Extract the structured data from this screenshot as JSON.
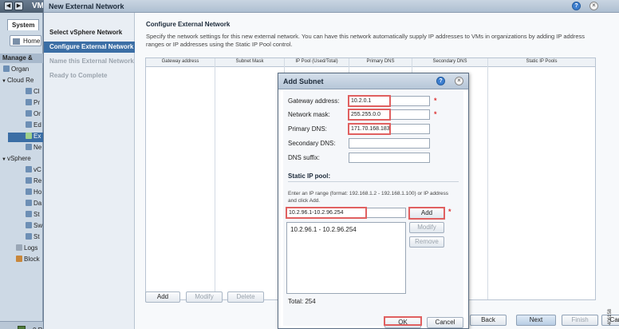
{
  "app": {
    "title_fragment": "VM"
  },
  "sidebar": {
    "tab": "System",
    "home": "Home",
    "manage": "Manage &",
    "items": [
      {
        "label": "Organ",
        "icon": "organization-icon"
      },
      {
        "label": "Cloud Re",
        "icon": "tree-expand-icon"
      },
      {
        "label": "Cl",
        "icon": "cloud-cell-icon"
      },
      {
        "label": "Pr",
        "icon": "provider-vdc-icon"
      },
      {
        "label": "Or",
        "icon": "org-vdc-icon"
      },
      {
        "label": "Ed",
        "icon": "edge-gateway-icon"
      },
      {
        "label": "Ex",
        "icon": "external-network-icon"
      },
      {
        "label": "Ne",
        "icon": "network-pool-icon"
      },
      {
        "label": "vSphere",
        "icon": "tree-expand-icon"
      },
      {
        "label": "vC",
        "icon": "vcenter-icon"
      },
      {
        "label": "Re",
        "icon": "resource-pool-icon"
      },
      {
        "label": "Ho",
        "icon": "host-icon"
      },
      {
        "label": "Da",
        "icon": "datastore-icon"
      },
      {
        "label": "St",
        "icon": "storage-policy-icon"
      },
      {
        "label": "Sw",
        "icon": "switch-icon"
      },
      {
        "label": "St",
        "icon": "stranded-items-icon"
      },
      {
        "label": "Logs",
        "icon": "logs-icon"
      },
      {
        "label": "Block",
        "icon": "blocking-tasks-icon"
      }
    ],
    "status": "0 R"
  },
  "wizard": {
    "title": "New External Network",
    "steps": [
      "Select vSphere Network",
      "Configure External Network",
      "Name this External Network",
      "Ready to Complete"
    ],
    "heading": "Configure External Network",
    "description": "Specify the network settings for this new external network. You can have this network automatically supply IP addresses to VMs in organizations by adding IP address ranges or IP addresses using the Static IP Pool control.",
    "columns": [
      "Gateway address",
      "Subnet Mask",
      "IP Pool (Used/Total)",
      "Primary DNS",
      "Secondary DNS",
      "Static IP Pools"
    ],
    "grid_buttons": {
      "add": "Add",
      "modify": "Modify",
      "delete": "Delete"
    },
    "footer": {
      "back": "Back",
      "next": "Next",
      "finish": "Finish",
      "cancel": "Cancel"
    }
  },
  "dialog": {
    "title": "Add Subnet",
    "gateway_label": "Gateway address:",
    "gateway_value": "10.2.0.1",
    "mask_label": "Network mask:",
    "mask_value": "255.255.0.0",
    "primary_dns_label": "Primary DNS:",
    "primary_dns_value": "171.70.168.183",
    "secondary_dns_label": "Secondary DNS:",
    "secondary_dns_value": "",
    "dns_suffix_label": "DNS suffix:",
    "dns_suffix_value": "",
    "static_pool_heading": "Static IP pool:",
    "hint": "Enter an IP range (format: 192.168.1.2 - 192.168.1.100) or IP address and click Add.",
    "range_value": "10.2.96.1-10.2.96.254",
    "pool_items": [
      "10.2.96.1 - 10.2.96.254"
    ],
    "add_label": "Add",
    "modify_label": "Modify",
    "remove_label": "Remove",
    "total": "Total: 254",
    "ok_label": "OK",
    "cancel_label": "Cancel",
    "required_mark": "*"
  },
  "figure_id": "406158",
  "colors": {
    "highlight": "#e06060",
    "accent": "#3b6ea5",
    "required": "#dd3333"
  }
}
